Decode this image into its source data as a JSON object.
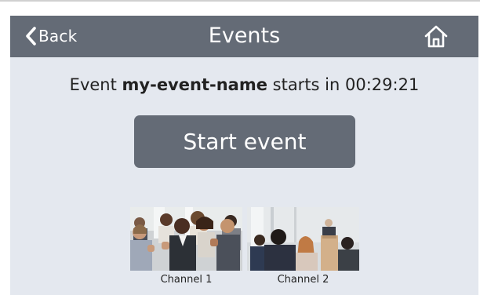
{
  "header": {
    "back_label": "Back",
    "title": "Events",
    "home_icon": "home-icon",
    "back_icon": "chevron-left-icon"
  },
  "status": {
    "prefix": "Event",
    "event_name": "my-event-name",
    "middle": "starts in",
    "countdown": "00:29:21"
  },
  "start_button": {
    "label": "Start event"
  },
  "channels": [
    {
      "label": "Channel 1",
      "thumbnail": "audience-clapping"
    },
    {
      "label": "Channel 2",
      "thumbnail": "speaker-at-podium"
    }
  ],
  "colors": {
    "header_bg": "#646b76",
    "panel_bg": "#e4e8ef",
    "button_bg": "#646b76"
  }
}
